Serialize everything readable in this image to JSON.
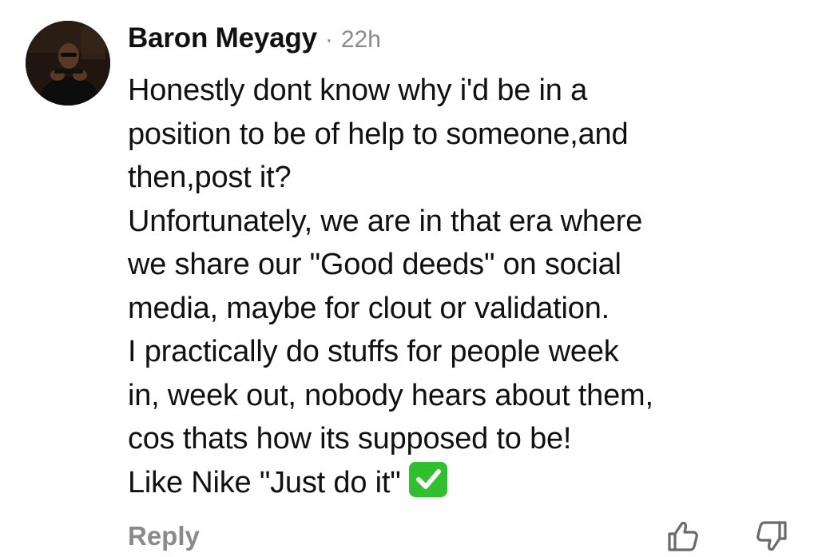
{
  "comment": {
    "author": "Baron Meyagy",
    "separator": "·",
    "time": "22h",
    "lines": [
      "Honestly dont know why i'd be in a",
      "position to be of help to someone,and",
      "then,post it?",
      "Unfortunately, we are in that era where",
      "we share our \"Good deeds\" on social",
      "media, maybe for clout or validation.",
      "I practically do stuffs for people week",
      "in, week out, nobody hears about them,",
      "cos thats how its supposed to be!",
      "Like Nike \"Just do it\""
    ],
    "emoji": "check-mark-button-emoji"
  },
  "actions": {
    "reply_label": "Reply",
    "like_icon": "thumbs-up-icon",
    "dislike_icon": "thumbs-down-icon"
  },
  "colors": {
    "text": "#111111",
    "muted": "#8a8a8a",
    "check_green": "#2fbf2f"
  }
}
